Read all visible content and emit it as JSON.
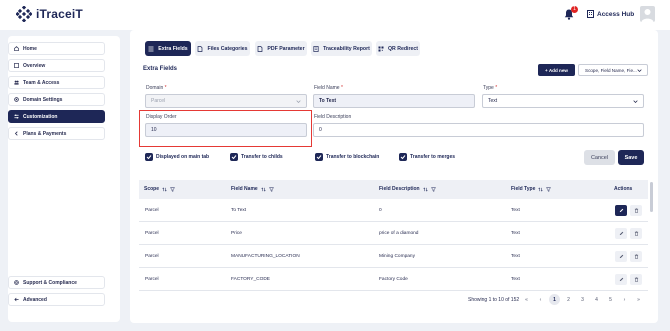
{
  "app": {
    "logo_text": "iTraceiT",
    "notification_count": "1",
    "access_hub": "Access Hub"
  },
  "sidebar": {
    "items": [
      {
        "label": "Home"
      },
      {
        "label": "Overview"
      },
      {
        "label": "Team & Access"
      },
      {
        "label": "Domain Settings"
      },
      {
        "label": "Customization"
      },
      {
        "label": "Plans & Payments"
      }
    ],
    "bottom": [
      {
        "label": "Support & Compliance"
      },
      {
        "label": "Advanced"
      }
    ]
  },
  "tabs": [
    {
      "label": "Extra Fields"
    },
    {
      "label": "Files Categories"
    },
    {
      "label": "PDF Parameter"
    },
    {
      "label": "Traceability Report"
    },
    {
      "label": "QR Redirect"
    }
  ],
  "section": {
    "title": "Extra Fields",
    "add_new": "+ Add new",
    "scope_filter": "Scope, Field Name, Fie..."
  },
  "form": {
    "domain_label": "Domain",
    "domain_value": "Parcel",
    "field_name_label": "Field Name",
    "field_name_value": "To Text",
    "type_label": "Type",
    "type_value": "Text",
    "display_order_label": "Display Order",
    "display_order_value": "10",
    "field_description_label": "Field Description",
    "field_description_value": "0",
    "required_mark": "*"
  },
  "checkboxes": [
    {
      "label": "Displayed on main tab",
      "checked": true
    },
    {
      "label": "Transfer to childs",
      "checked": true
    },
    {
      "label": "Transfer to blockchain",
      "checked": true
    },
    {
      "label": "Transfer to merges",
      "checked": true
    }
  ],
  "buttons": {
    "cancel": "Cancel",
    "save": "Save"
  },
  "table": {
    "headers": [
      "Scope",
      "Field Name",
      "Field Description",
      "Field Type",
      "Actions"
    ],
    "rows": [
      {
        "scope": "Parcel",
        "name": "To Text",
        "description": "0",
        "type": "Text"
      },
      {
        "scope": "Parcel",
        "name": "Price",
        "description": "price of a diamond",
        "type": "Text"
      },
      {
        "scope": "Parcel",
        "name": "MANUFACTURING_LOCATION",
        "description": "Mining Company",
        "type": "Text"
      },
      {
        "scope": "Parcel",
        "name": "FACTORY_CODE",
        "description": "Factory Code",
        "type": "Text"
      }
    ]
  },
  "pagination": {
    "info": "Showing 1 to 10 of 152",
    "first": "«",
    "prev": "‹",
    "pages": [
      "1",
      "2",
      "3",
      "4",
      "5"
    ],
    "next": "›",
    "last": "»",
    "current_page": "1"
  },
  "colors": {
    "primary": "#1e2757",
    "highlight": "#e53935",
    "badge": "#e02424"
  }
}
